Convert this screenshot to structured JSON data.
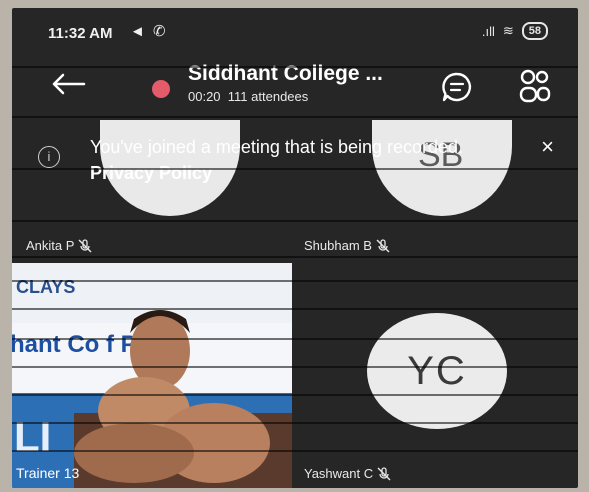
{
  "status_bar": {
    "time": "11:32 AM",
    "left_icons": "◄ ✆",
    "signal": ".ıll",
    "wifi": "≋",
    "battery": "58"
  },
  "header": {
    "title": "Siddhant College ...",
    "duration": "00:20",
    "attendees": "111 attendees"
  },
  "banner": {
    "message": "You've joined a meeting that is being recorded.",
    "link": "Privacy Policy",
    "close": "×"
  },
  "participants": {
    "p1_name": "Ankita P",
    "p2_name": "Shubham B",
    "p2_initials": "SB",
    "p3_name": "Trainer 13",
    "p4_name": "Yashwant C",
    "p4_initials": "YC"
  },
  "video": {
    "slide_logo": "CLAYS",
    "slide_text": "hant Co        f Phar",
    "slide_bottom": "LI"
  },
  "colors": {
    "record": "#e45b6a",
    "screen_bg": "#262626",
    "avatar_bg": "#ebebeb"
  }
}
